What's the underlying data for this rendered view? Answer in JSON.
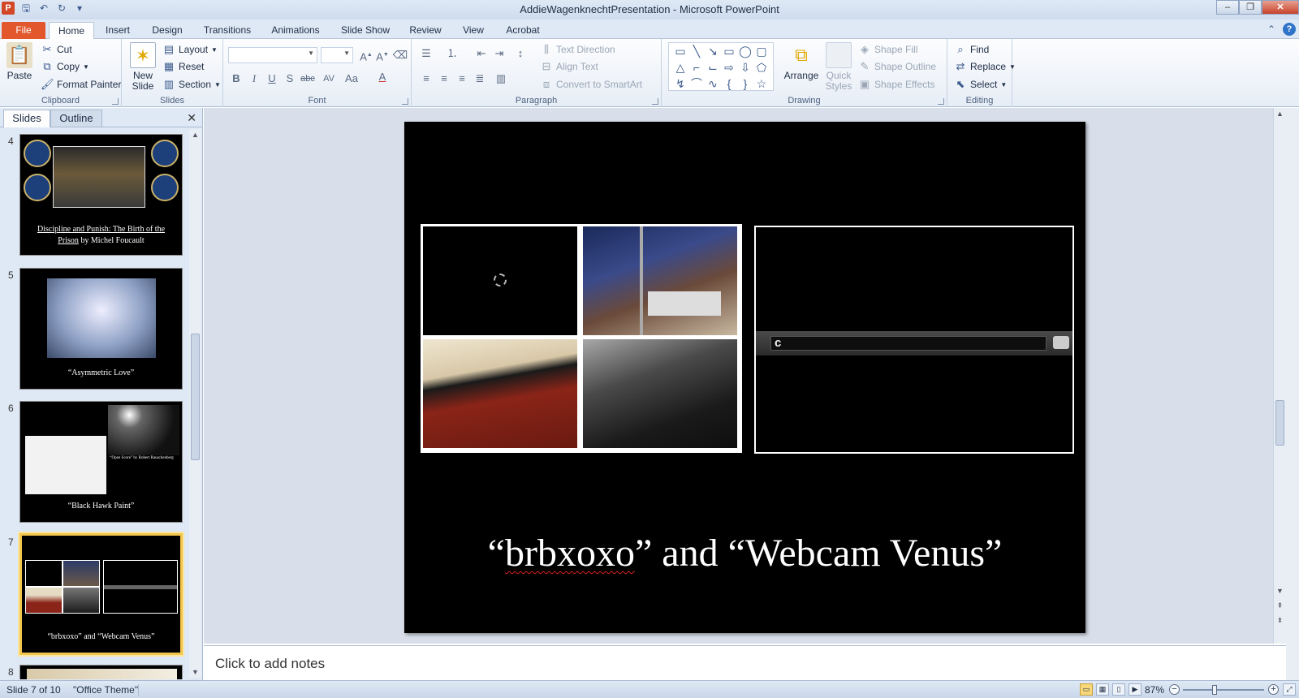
{
  "window": {
    "title": "AddieWagenknechtPresentation - Microsoft PowerPoint",
    "controls": [
      "–",
      "❐",
      "✕"
    ]
  },
  "tabs": [
    "File",
    "Home",
    "Insert",
    "Design",
    "Transitions",
    "Animations",
    "Slide Show",
    "Review",
    "View",
    "Acrobat"
  ],
  "ribbon": {
    "clipboard": {
      "label": "Clipboard",
      "paste": "Paste",
      "cut": "Cut",
      "copy": "Copy",
      "format_painter": "Format Painter"
    },
    "slides": {
      "label": "Slides",
      "new_slide_1": "New",
      "new_slide_2": "Slide",
      "layout": "Layout",
      "reset": "Reset",
      "section": "Section"
    },
    "font": {
      "label": "Font",
      "bold": "B",
      "italic": "I",
      "underline": "U",
      "shadow": "S",
      "strike": "abc",
      "spacing": "AV",
      "case": "Aa",
      "color": "A"
    },
    "paragraph": {
      "label": "Paragraph",
      "text_direction": "Text Direction",
      "align_text": "Align Text",
      "convert_smartart": "Convert to SmartArt"
    },
    "drawing": {
      "label": "Drawing",
      "arrange": "Arrange",
      "quick_styles_1": "Quick",
      "quick_styles_2": "Styles",
      "shape_fill": "Shape Fill",
      "shape_outline": "Shape Outline",
      "shape_effects": "Shape Effects"
    },
    "editing": {
      "label": "Editing",
      "find": "Find",
      "replace": "Replace",
      "select": "Select"
    }
  },
  "panel": {
    "tab_slides": "Slides",
    "tab_outline": "Outline",
    "thumbs": [
      {
        "num": "4",
        "caption_u1": "Discipline and Punish: The Birth of the",
        "caption_u2": "Prison",
        "caption_rest": " by Michel Foucault"
      },
      {
        "num": "5",
        "caption": "“Asymmetric Love”"
      },
      {
        "num": "6",
        "caption": "“Black Hawk Paint”",
        "small_caption": "“Open Score” by Robert Rauschenberg"
      },
      {
        "num": "7",
        "caption": "“brbxoxo” and “Webcam Venus”"
      },
      {
        "num": "8"
      }
    ]
  },
  "slide": {
    "title_part1": "“",
    "title_word": "brbxoxo",
    "title_part2": "” and “Webcam Venus”",
    "chat_text": "c"
  },
  "notes": {
    "placeholder": "Click to add notes"
  },
  "status": {
    "slide_info": "Slide 7 of 10",
    "theme": "\"Office Theme\"",
    "zoom": "87%"
  },
  "colors": {
    "file_tab": "#e2572c",
    "selection": "#f2c64d",
    "slide_bg": "#000000"
  }
}
